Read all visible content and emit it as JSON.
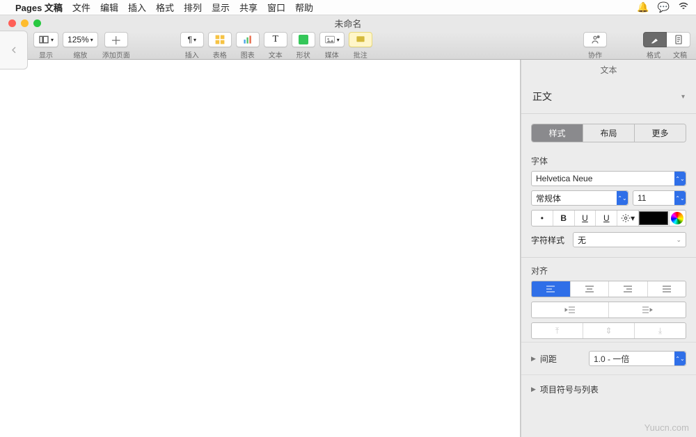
{
  "menubar": {
    "app": "Pages 文稿",
    "items": [
      "文件",
      "编辑",
      "插入",
      "格式",
      "排列",
      "显示",
      "共享",
      "窗口",
      "帮助"
    ]
  },
  "window": {
    "title": "未命名"
  },
  "toolbar": {
    "view": {
      "label": "显示"
    },
    "zoom": {
      "value": "125%",
      "label": "缩放"
    },
    "addpage": {
      "label": "添加页面"
    },
    "insert": {
      "label": "插入"
    },
    "table": {
      "label": "表格"
    },
    "chart": {
      "label": "图表"
    },
    "text": {
      "label": "文本"
    },
    "shape": {
      "label": "形状"
    },
    "media": {
      "label": "媒体"
    },
    "comment": {
      "label": "批注"
    },
    "collab": {
      "label": "协作"
    },
    "format": {
      "label": "格式"
    },
    "document": {
      "label": "文稿"
    }
  },
  "inspector": {
    "header": "文本",
    "style_name": "正文",
    "tabs": {
      "style": "样式",
      "layout": "布局",
      "more": "更多"
    },
    "font": {
      "label": "字体",
      "family": "Helvetica Neue",
      "weight": "常规体",
      "size": "11",
      "charstyle_label": "字符样式",
      "charstyle_value": "无"
    },
    "align": {
      "label": "对齐"
    },
    "spacing": {
      "label": "间距",
      "value": "1.0 - 一倍"
    },
    "lists": {
      "label": "项目符号与列表"
    }
  },
  "watermark": "Yuucn.com"
}
